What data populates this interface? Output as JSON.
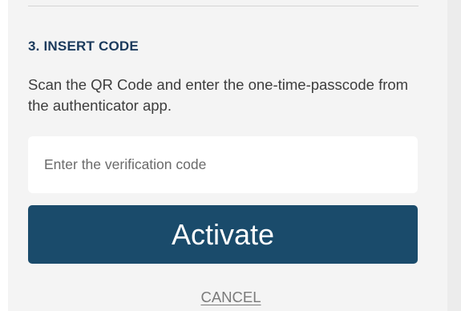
{
  "step": {
    "title": "3. INSERT CODE",
    "instructions": "Scan the QR Code and enter the one-time-passcode from the authenticator app."
  },
  "verification": {
    "placeholder": "Enter the verification code",
    "value": ""
  },
  "actions": {
    "activate_label": "Activate",
    "cancel_label": "CANCEL"
  },
  "colors": {
    "heading": "#1b3a5c",
    "button": "#1a4b6b",
    "card_background": "#f4f4f4",
    "page_background": "#ececec"
  }
}
